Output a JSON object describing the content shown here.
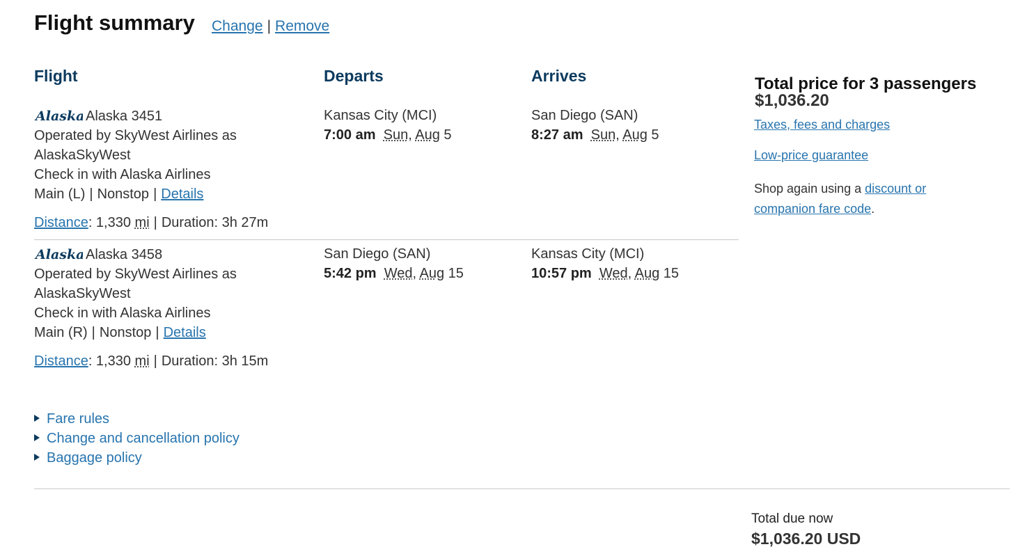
{
  "header": {
    "title": "Flight summary",
    "change_label": "Change",
    "remove_label": "Remove",
    "separator": "|"
  },
  "columns": {
    "flight": "Flight",
    "departs": "Departs",
    "arrives": "Arrives"
  },
  "flights": [
    {
      "airline_logo": "Alaska",
      "flight_number": "Alaska 3451",
      "operated_by_1": "Operated by SkyWest Airlines as",
      "operated_by_2": "AlaskaSkyWest",
      "check_in": "Check in with Alaska Airlines",
      "cabin": "Main (L)",
      "stops": "Nonstop",
      "details_label": "Details",
      "distance_label": "Distance",
      "distance_value": ": 1,330",
      "distance_unit": "mi",
      "duration": "Duration: 3h 27m",
      "depart_city": "Kansas City (MCI)",
      "depart_time": "7:00 am",
      "depart_day": "Sun",
      "depart_month": "Aug",
      "depart_date": "5",
      "arrive_city": "San Diego (SAN)",
      "arrive_time": "8:27 am",
      "arrive_day": "Sun",
      "arrive_month": "Aug",
      "arrive_date": "5"
    },
    {
      "airline_logo": "Alaska",
      "flight_number": "Alaska 3458",
      "operated_by_1": "Operated by SkyWest Airlines as",
      "operated_by_2": "AlaskaSkyWest",
      "check_in": "Check in with Alaska Airlines",
      "cabin": "Main (R)",
      "stops": "Nonstop",
      "details_label": "Details",
      "distance_label": "Distance",
      "distance_value": ": 1,330",
      "distance_unit": "mi",
      "duration": "Duration: 3h 15m",
      "depart_city": "San Diego (SAN)",
      "depart_time": "5:42 pm",
      "depart_day": "Wed",
      "depart_month": "Aug",
      "depart_date": "15",
      "arrive_city": "Kansas City (MCI)",
      "arrive_time": "10:57 pm",
      "arrive_day": "Wed",
      "arrive_month": "Aug",
      "arrive_date": "15"
    }
  ],
  "summary": {
    "title": "Total price for 3 passengers",
    "price": "$1,036.20",
    "taxes_link": "Taxes, fees and charges",
    "guarantee_link": "Low-price guarantee",
    "shop_again_prefix": "Shop again using a ",
    "discount_link_1": "discount or",
    "discount_link_2": "companion fare code",
    "shop_again_suffix": "."
  },
  "policies": [
    {
      "label": "Fare rules"
    },
    {
      "label": "Change and cancellation policy"
    },
    {
      "label": "Baggage policy"
    }
  ],
  "total_due": {
    "label": "Total due now",
    "amount": "$1,036.20 USD"
  },
  "colors": {
    "link": "#2774ae",
    "heading": "#0b3a5e",
    "logo": "#0b3a5e"
  }
}
